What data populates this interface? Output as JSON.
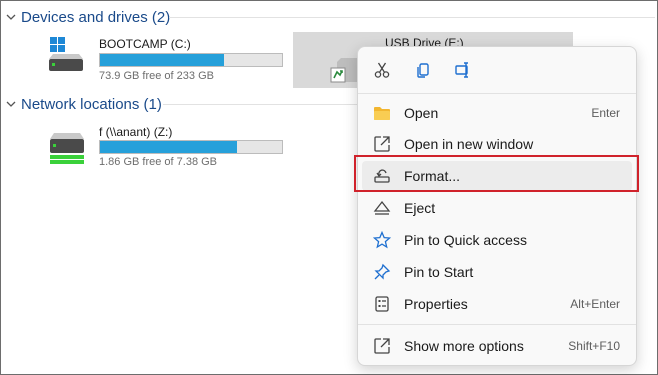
{
  "groups": {
    "devices": "Devices and drives (2)",
    "network": "Network locations (1)"
  },
  "drives": [
    {
      "name": "BOOTCAMP (C:)",
      "free": "73.9 GB free of 233 GB",
      "used_fraction": 0.68
    },
    {
      "name": "USB Drive (E:)"
    }
  ],
  "network_drives": [
    {
      "name": "f (\\\\anant) (Z:)",
      "free": "1.86 GB free of 7.38 GB",
      "used_fraction": 0.75
    }
  ],
  "context_menu": {
    "toolbar": [
      "cut-icon",
      "copy-icon",
      "rename-icon"
    ],
    "items": [
      {
        "label": "Open",
        "shortcut": "Enter",
        "icon": "folder-icon"
      },
      {
        "label": "Open in new window",
        "shortcut": "",
        "icon": "open-new-window-icon"
      },
      {
        "label": "Format...",
        "shortcut": "",
        "icon": "format-icon"
      },
      {
        "label": "Eject",
        "shortcut": "",
        "icon": "eject-icon"
      },
      {
        "label": "Pin to Quick access",
        "shortcut": "",
        "icon": "star-icon"
      },
      {
        "label": "Pin to Start",
        "shortcut": "",
        "icon": "pin-icon"
      },
      {
        "label": "Properties",
        "shortcut": "Alt+Enter",
        "icon": "properties-icon"
      },
      {
        "label": "Show more options",
        "shortcut": "Shift+F10",
        "icon": "more-options-icon"
      }
    ]
  },
  "colors": {
    "accent_blue": "#26a0da",
    "group_header": "#1a4a8a",
    "highlight_red": "#d0222b",
    "selected_bg": "#d9d9d9"
  }
}
